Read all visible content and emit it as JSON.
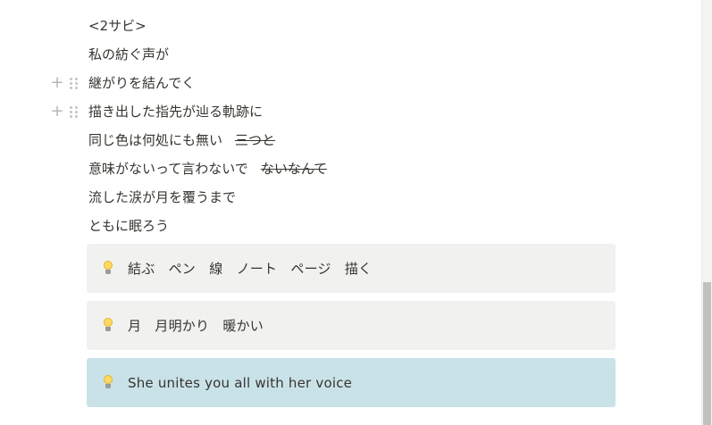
{
  "lines": [
    {
      "text": "<2サビ>"
    },
    {
      "text": "私の紡ぐ声が"
    },
    {
      "text": "継がりを結んでく"
    },
    {
      "text": "描き出した指先が辿る軌跡に"
    },
    {
      "text": "同じ色は何処にも無い",
      "struck": "三つと"
    },
    {
      "text": "意味がないって言わないで",
      "struck": "ないなんて"
    },
    {
      "text": "流した涙が月を覆うまで"
    },
    {
      "text": "ともに眠ろう"
    }
  ],
  "block_controls": {
    "add_icon": "plus-icon",
    "drag_icon": "drag-handle-icon"
  },
  "callouts": [
    {
      "icon": "lightbulb-icon",
      "text": "結ぶ　ペン　線　ノート　ページ　描く",
      "background": "#f1f1ef"
    },
    {
      "icon": "lightbulb-icon",
      "text": "月　月明かり　暖かい",
      "background": "#f1f1ef"
    },
    {
      "icon": "lightbulb-icon",
      "text": "She unites you all with her voice",
      "background": "#c9e2e8"
    }
  ]
}
